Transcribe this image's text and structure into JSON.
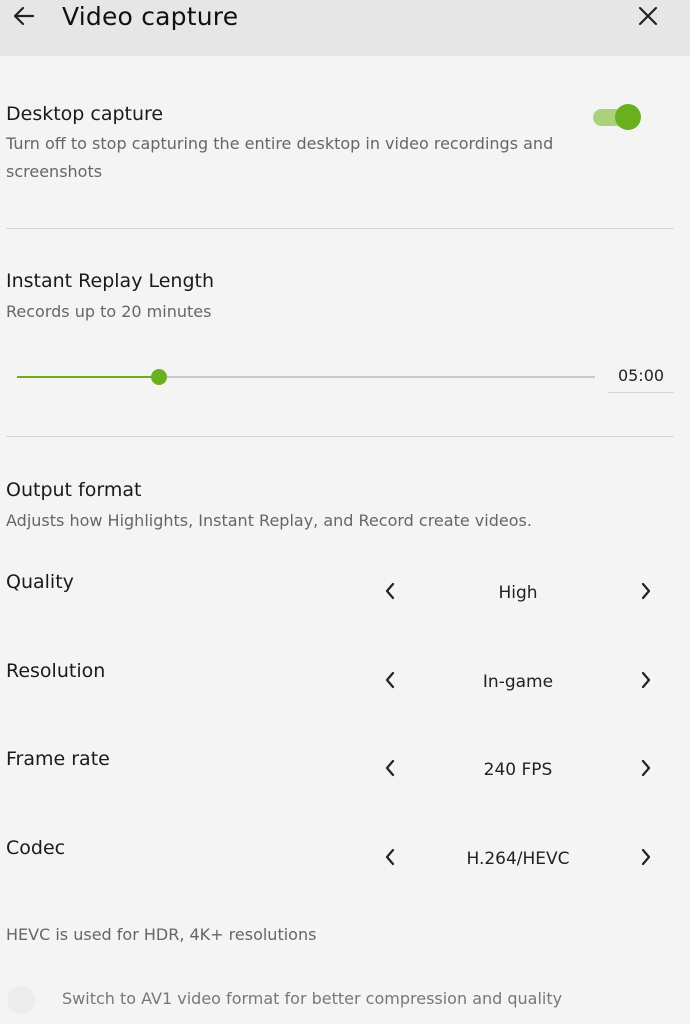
{
  "header": {
    "title": "Video capture",
    "back_icon": "arrow-left-icon",
    "close_icon": "close-icon"
  },
  "desktop_capture": {
    "title": "Desktop capture",
    "description": "Turn off to stop capturing the entire desktop in video recordings and screenshots",
    "enabled": true
  },
  "instant_replay": {
    "title": "Instant Replay Length",
    "description": "Records up to 20 minutes",
    "slider_fraction": 0.245,
    "value": "05:00"
  },
  "output_format": {
    "title": "Output format",
    "description": "Adjusts how Highlights, Instant Replay, and Record create videos.",
    "rows": [
      {
        "label": "Quality",
        "value": "High"
      },
      {
        "label": "Resolution",
        "value": "In-game"
      },
      {
        "label": "Frame rate",
        "value": "240 FPS"
      },
      {
        "label": "Codec",
        "value": "H.264/HEVC"
      }
    ],
    "note": "HEVC is used for HDR, 4K+ resolutions",
    "av1_option": "Switch to AV1 video format for better compression and quality"
  },
  "colors": {
    "accent": "#69b01e",
    "accent_light": "#a9d27a",
    "header_bg": "#e6e6e6",
    "page_bg": "#f4f4f4"
  }
}
